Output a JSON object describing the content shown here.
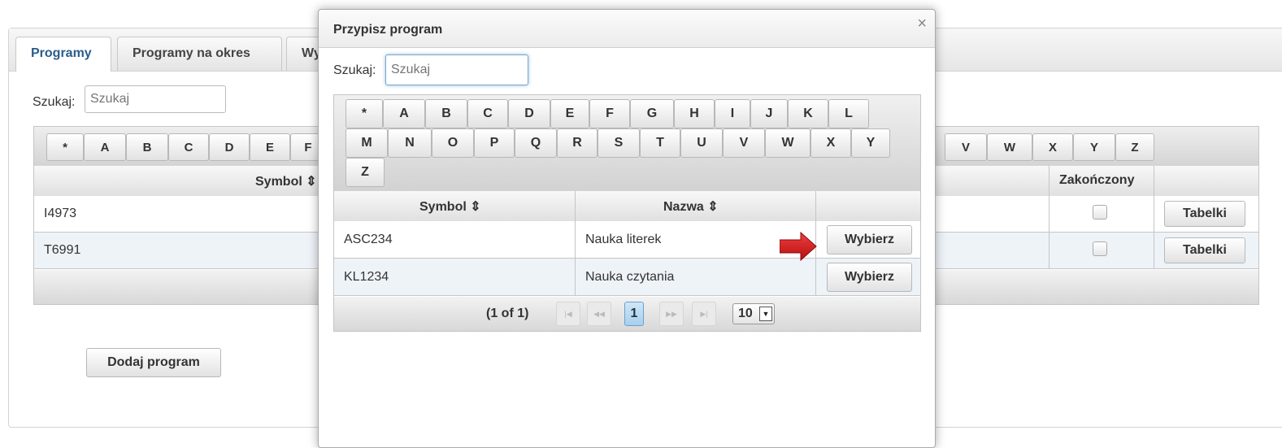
{
  "background": {
    "tabs": [
      {
        "label": "Programy",
        "active": true
      },
      {
        "label": "Programy na okres",
        "active": false
      },
      {
        "label": "Wy",
        "active": false
      }
    ],
    "search_label": "Szukaj:",
    "search_placeholder": "Szukaj",
    "alphabet_left": [
      "*",
      "A",
      "B",
      "C",
      "D",
      "E",
      "F"
    ],
    "alphabet_right": [
      "V",
      "W",
      "X",
      "Y",
      "Z"
    ],
    "columns": {
      "symbol": "Symbol ⇕",
      "finished": "Zakończony"
    },
    "rows": [
      {
        "symbol": "I4973",
        "action": "Tabelki"
      },
      {
        "symbol": "T6991",
        "action": "Tabelki"
      }
    ],
    "add_button": "Dodaj program"
  },
  "modal": {
    "title": "Przypisz program",
    "close_icon": "close-icon",
    "search_label": "Szukaj:",
    "search_placeholder": "Szukaj",
    "alphabet_row1": [
      "*",
      "A",
      "B",
      "C",
      "D",
      "E",
      "F",
      "G",
      "H",
      "I",
      "J",
      "K",
      "L"
    ],
    "alphabet_row2": [
      "M",
      "N",
      "O",
      "P",
      "Q",
      "R",
      "S",
      "T",
      "U",
      "V",
      "W",
      "X",
      "Y"
    ],
    "alphabet_row3": [
      "Z"
    ],
    "columns": {
      "symbol": "Symbol ⇕",
      "name": "Nazwa ⇕"
    },
    "rows": [
      {
        "symbol": "ASC234",
        "name": "Nauka literek",
        "action": "Wybierz"
      },
      {
        "symbol": "KL1234",
        "name": "Nauka czytania",
        "action": "Wybierz"
      }
    ],
    "pagination": {
      "info": "(1 of 1)",
      "current_page": "1",
      "page_size": "10",
      "nav_icons": [
        "first-page-icon",
        "prev-page-icon",
        "next-page-icon",
        "last-page-icon"
      ]
    },
    "annotation": "red-arrow-icon"
  },
  "colors": {
    "active_tab": "#2a5d8c",
    "arrow": "#d21f1f",
    "focus": "#7aa7cc"
  }
}
